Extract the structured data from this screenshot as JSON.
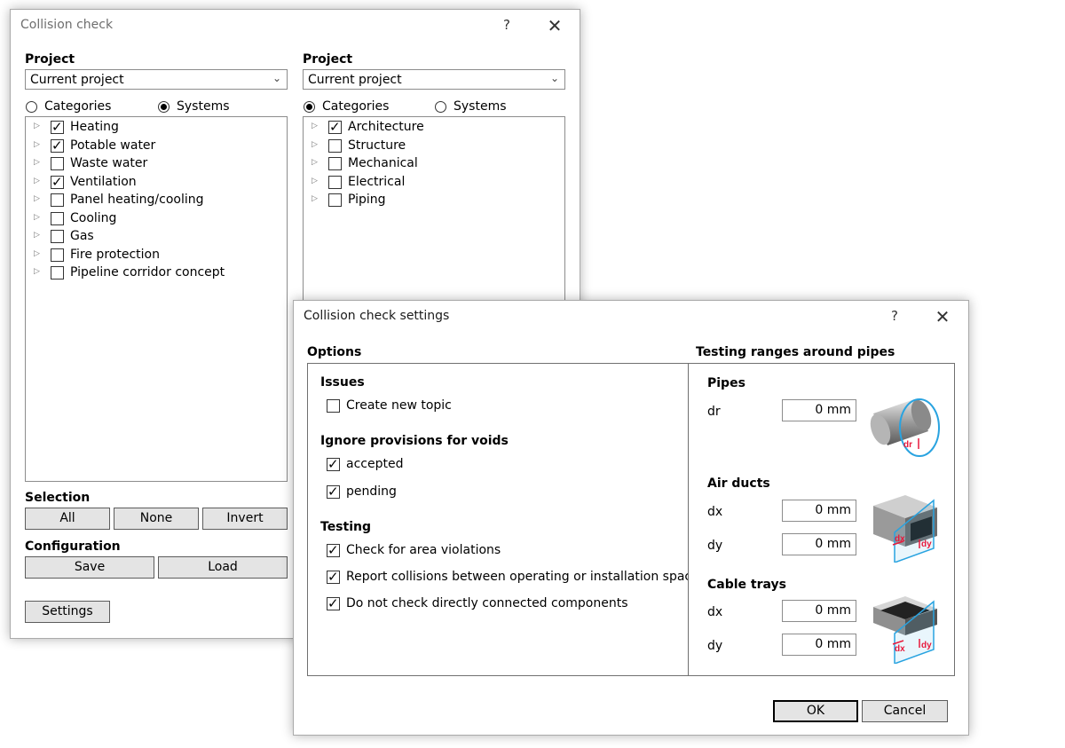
{
  "main_dialog": {
    "title": "Collision check",
    "help": "?",
    "close": "✕",
    "left": {
      "heading": "Project",
      "project": "Current project",
      "radio_categories": "Categories",
      "radio_systems": "Systems",
      "selected_mode": "systems",
      "items": [
        {
          "label": "Heating",
          "checked": true
        },
        {
          "label": "Potable water",
          "checked": true
        },
        {
          "label": "Waste water",
          "checked": false
        },
        {
          "label": "Ventilation",
          "checked": true
        },
        {
          "label": "Panel heating/cooling",
          "checked": false
        },
        {
          "label": "Cooling",
          "checked": false
        },
        {
          "label": "Gas",
          "checked": false
        },
        {
          "label": "Fire protection",
          "checked": false
        },
        {
          "label": "Pipeline corridor concept",
          "checked": false
        }
      ]
    },
    "right": {
      "heading": "Project",
      "project": "Current project",
      "radio_categories": "Categories",
      "radio_systems": "Systems",
      "selected_mode": "categories",
      "items": [
        {
          "label": "Architecture",
          "checked": true
        },
        {
          "label": "Structure",
          "checked": false
        },
        {
          "label": "Mechanical",
          "checked": false
        },
        {
          "label": "Electrical",
          "checked": false
        },
        {
          "label": "Piping",
          "checked": false
        }
      ]
    },
    "selection": {
      "heading": "Selection",
      "all": "All",
      "none": "None",
      "invert": "Invert"
    },
    "configuration": {
      "heading": "Configuration",
      "save": "Save",
      "load": "Load"
    },
    "settings_button": "Settings"
  },
  "settings_dialog": {
    "title": "Collision check settings",
    "help": "?",
    "close": "✕",
    "options_heading": "Options",
    "ranges_heading": "Testing ranges around pipes",
    "issues": {
      "heading": "Issues",
      "create_new_topic": {
        "label": "Create new topic",
        "checked": false
      }
    },
    "ignore": {
      "heading": "Ignore provisions for voids",
      "accepted": {
        "label": "accepted",
        "checked": true
      },
      "pending": {
        "label": "pending",
        "checked": true
      }
    },
    "testing": {
      "heading": "Testing",
      "area": {
        "label": "Check for area violations",
        "checked": true
      },
      "report": {
        "label": "Report collisions between operating or installation spaces",
        "checked": true
      },
      "connected": {
        "label": "Do not check directly connected components",
        "checked": true
      }
    },
    "pipes": {
      "heading": "Pipes",
      "dr_label": "dr",
      "dr_value": "0 mm",
      "icon_label": "dr"
    },
    "air_ducts": {
      "heading": "Air ducts",
      "dx_label": "dx",
      "dx_value": "0 mm",
      "dy_label": "dy",
      "dy_value": "0 mm"
    },
    "cable_trays": {
      "heading": "Cable trays",
      "dx_label": "dx",
      "dx_value": "0 mm",
      "dy_label": "dy",
      "dy_value": "0 mm"
    },
    "icon_dx": "dx",
    "icon_dy": "dy",
    "ok": "OK",
    "cancel": "Cancel",
    "accent_color": "#e8193c",
    "frame_color": "#29a3e0"
  }
}
